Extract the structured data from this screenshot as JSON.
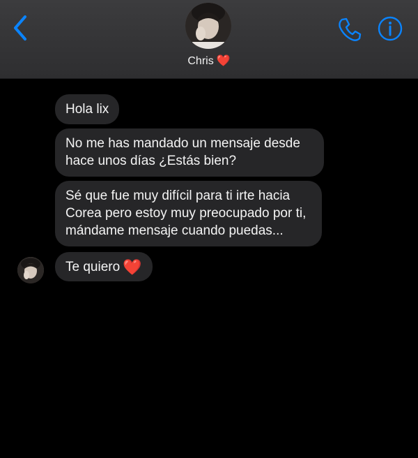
{
  "header": {
    "contact_name": "Chris",
    "contact_emoji": "❤️",
    "back_icon": "chevron-left-icon",
    "call_icon": "phone-icon",
    "info_icon": "info-icon",
    "accent_color": "#0a84ff"
  },
  "messages": [
    {
      "sender": "Chris",
      "text": "Hola lix"
    },
    {
      "sender": "Chris",
      "text": "No me has mandado un mensaje desde hace unos días ¿Estás bien?"
    },
    {
      "sender": "Chris",
      "text": "Sé que fue muy difícil para ti irte hacia Corea pero estoy muy preocupado por ti, mándame mensaje cuando puedas..."
    },
    {
      "sender": "Chris",
      "text": "Te quiero",
      "emoji": "❤️"
    }
  ]
}
